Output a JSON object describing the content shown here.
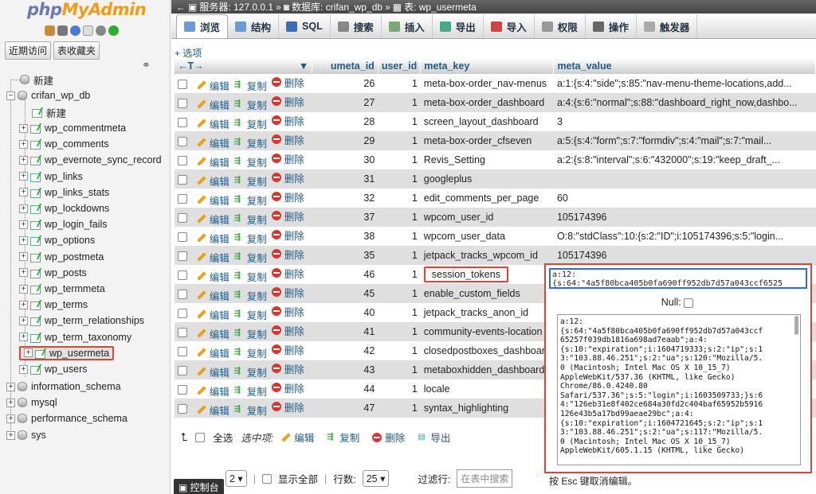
{
  "app": {
    "logo_a": "php",
    "logo_b": "MyAdmin"
  },
  "nav": {
    "recent": "近期访问",
    "favorites": "表收藏夹"
  },
  "tree": {
    "new": "新建",
    "db": "crifan_wp_db",
    "db_new": "新建",
    "tables": [
      "wp_commentmeta",
      "wp_comments",
      "wp_evernote_sync_record",
      "wp_links",
      "wp_links_stats",
      "wp_lockdowns",
      "wp_login_fails",
      "wp_options",
      "wp_postmeta",
      "wp_posts",
      "wp_termmeta",
      "wp_terms",
      "wp_term_relationships",
      "wp_term_taxonomy",
      "wp_usermeta",
      "wp_users"
    ],
    "selected": "wp_usermeta",
    "other_dbs": [
      "information_schema",
      "mysql",
      "performance_schema",
      "sys"
    ]
  },
  "breadcrumb": {
    "server": "服务器: 127.0.0.1",
    "db": "数据库: crifan_wp_db",
    "table": "表: wp_usermeta"
  },
  "tabs": [
    "浏览",
    "结构",
    "SQL",
    "搜索",
    "插入",
    "导出",
    "导入",
    "权限",
    "操作",
    "触发器"
  ],
  "options_link": "+ 选项",
  "columns": [
    "umeta_id",
    "user_id",
    "meta_key",
    "meta_value"
  ],
  "actions": {
    "edit": "编辑",
    "copy": "复制",
    "delete": "删除"
  },
  "rows": [
    {
      "id": "26",
      "uid": "1",
      "key": "meta-box-order_nav-menus",
      "val": "a:1:{s:4:\"side\";s:85:\"nav-menu-theme-locations,add..."
    },
    {
      "id": "27",
      "uid": "1",
      "key": "meta-box-order_dashboard",
      "val": "a:4:{s:6:\"normal\";s:88:\"dashboard_right_now,dashbo..."
    },
    {
      "id": "28",
      "uid": "1",
      "key": "screen_layout_dashboard",
      "val": "3"
    },
    {
      "id": "29",
      "uid": "1",
      "key": "meta-box-order_cfseven",
      "val": "a:5:{s:4:\"form\";s:7:\"formdiv\";s:4:\"mail\";s:7:\"mail..."
    },
    {
      "id": "30",
      "uid": "1",
      "key": "Revis_Setting",
      "val": "a:2:{s:8:\"interval\";s:6:\"432000\";s:19:\"keep_draft_..."
    },
    {
      "id": "31",
      "uid": "1",
      "key": "googleplus",
      "val": ""
    },
    {
      "id": "32",
      "uid": "1",
      "key": "edit_comments_per_page",
      "val": "60"
    },
    {
      "id": "37",
      "uid": "1",
      "key": "wpcom_user_id",
      "val": "105174396"
    },
    {
      "id": "38",
      "uid": "1",
      "key": "wpcom_user_data",
      "val": "O:8:\"stdClass\":10:{s:2:\"ID\";i:105174396;s:5:\"login..."
    },
    {
      "id": "35",
      "uid": "1",
      "key": "jetpack_tracks_wpcom_id",
      "val": "105174396"
    },
    {
      "id": "46",
      "uid": "1",
      "key": "session_tokens",
      "val": ""
    },
    {
      "id": "45",
      "uid": "1",
      "key": "enable_custom_fields",
      "val": ""
    },
    {
      "id": "40",
      "uid": "1",
      "key": "jetpack_tracks_anon_id",
      "val": ""
    },
    {
      "id": "41",
      "uid": "1",
      "key": "community-events-location",
      "val": ""
    },
    {
      "id": "42",
      "uid": "1",
      "key": "closedpostboxes_dashboard",
      "val": ""
    },
    {
      "id": "43",
      "uid": "1",
      "key": "metaboxhidden_dashboard",
      "val": ""
    },
    {
      "id": "44",
      "uid": "1",
      "key": "locale",
      "val": ""
    },
    {
      "id": "47",
      "uid": "1",
      "key": "syntax_highlighting",
      "val": ""
    }
  ],
  "bulk": {
    "select_all": "全选",
    "with_selected": "选中项:",
    "edit": "编辑",
    "copy": "复制",
    "delete": "删除",
    "export": "导出"
  },
  "paging": {
    "page": "2",
    "show_all": "显示全部",
    "rows_label": "行数:",
    "rows": "25",
    "filter_label": "过滤行:",
    "filter_placeholder": "在表中搜索"
  },
  "console": "控制台",
  "editor": {
    "inline": "a:12:\n{s:64:\"4a5f80bca405b0fa690ff952db7d57a043ccf6525",
    "null_label": "Null:",
    "text": "a:12:\n{s:64:\"4a5f80bca405b0fa690ff952db7d57a043ccf\n65257f039db1816a698ad7eaab\";a:4:\n{s:10:\"expiration\";i:1604719333;s:2:\"ip\";s:1\n3:\"103.88.46.251\";s:2:\"ua\";s:120:\"Mozilla/5.\n0 (Macintosh; Intel Mac OS X 10_15_7)\nAppleWebKit/537.36 (KHTML, like Gecko)\nChrome/86.0.4240.80\nSafari/537.36\";s:5:\"login\";i:1603509733;}s:6\n4:\"126eb31e8f402ce684a30fd2c404baf65952b5916\n126e43b5a17bd99aeae29bc\";a:4:\n{s:10:\"expiration\";i:1604721645;s:2:\"ip\";s:1\n3:\"103.88.46.251\";s:2:\"ua\";s:117:\"Mozilla/5.\n0 (Macintosh; Intel Mac OS X 10_15_7)\nAppleWebKit/605.1.15 (KHTML, like Gecko)",
    "esc_hint": "按 Esc 键取消编辑。"
  }
}
